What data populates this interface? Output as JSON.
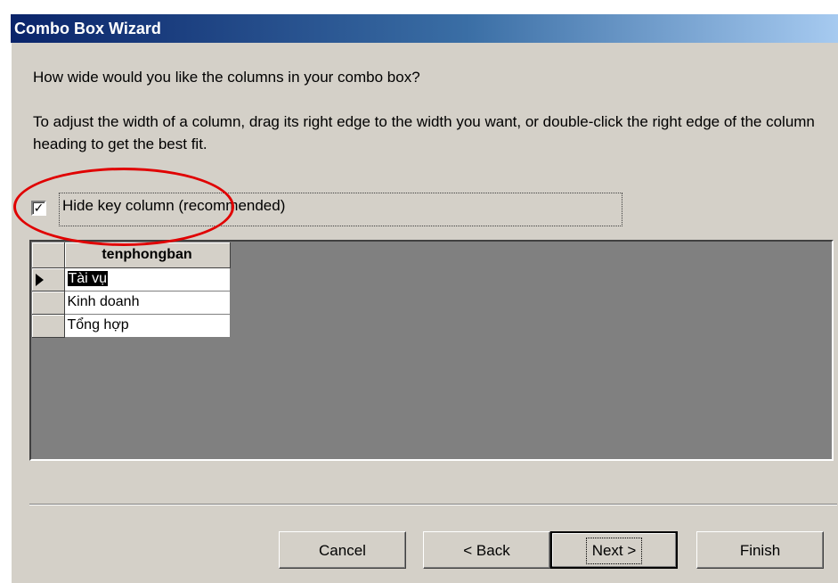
{
  "window": {
    "title": "Combo Box Wizard"
  },
  "content": {
    "question": "How wide would you like the columns in your combo box?",
    "instruction": "To adjust the width of a column, drag its right edge to the width you want, or double-click the right edge of the column heading to get the best fit."
  },
  "checkbox": {
    "label": "Hide key column (recommended)",
    "checked": true
  },
  "grid": {
    "header": "tenphongban",
    "rows": [
      "Tài vụ",
      "Kinh doanh",
      "Tổng hợp"
    ],
    "selected_row": 0
  },
  "buttons": {
    "cancel": "Cancel",
    "back": "< Back",
    "next": "Next >",
    "finish": "Finish"
  },
  "annotation": {
    "color": "#e00000"
  }
}
